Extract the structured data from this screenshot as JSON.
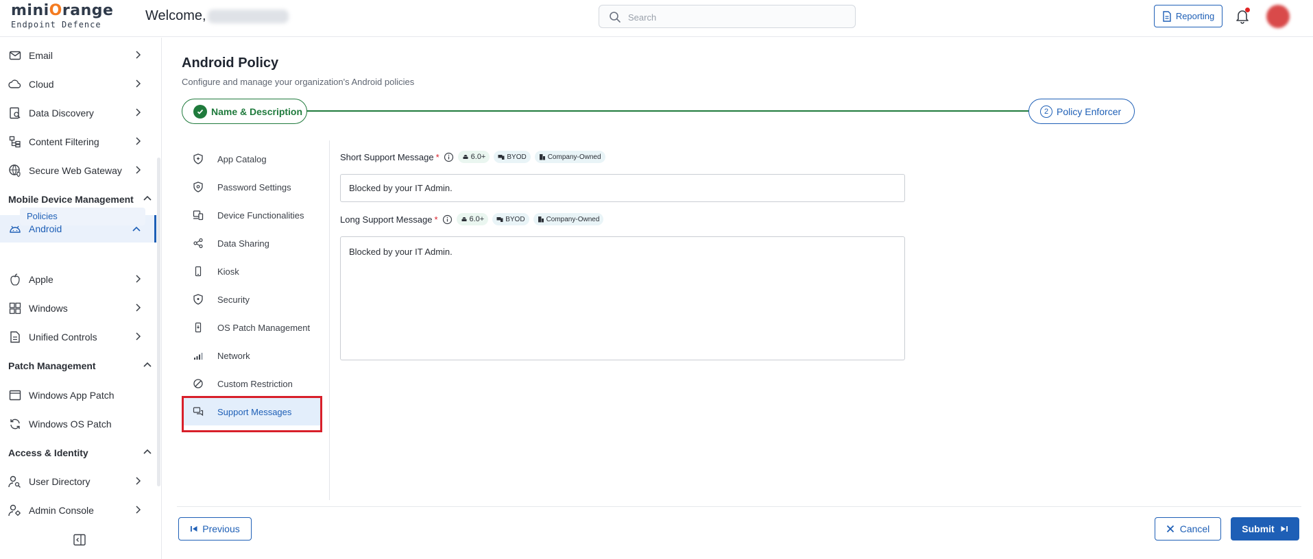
{
  "header": {
    "brand_prefix": "mini",
    "brand_o": "O",
    "brand_suffix": "range",
    "brand_sub": "Endpoint Defence",
    "welcome": "Welcome,",
    "search_placeholder": "Search",
    "reporting_label": "Reporting"
  },
  "sidebar": {
    "items": [
      {
        "label": "Email",
        "icon": "mail-icon"
      },
      {
        "label": "Cloud",
        "icon": "cloud-icon"
      },
      {
        "label": "Data Discovery",
        "icon": "document-search-icon"
      },
      {
        "label": "Content Filtering",
        "icon": "filter-list-icon"
      },
      {
        "label": "Secure Web Gateway",
        "icon": "globe-shield-icon"
      }
    ],
    "section_mdm": "Mobile Device Management",
    "android_label": "Android",
    "policies_label": "Policies",
    "apple_label": "Apple",
    "windows_label": "Windows",
    "unified_label": "Unified Controls",
    "section_patch": "Patch Management",
    "windows_app_patch": "Windows App Patch",
    "windows_os_patch": "Windows OS Patch",
    "section_access": "Access & Identity",
    "user_directory": "User Directory",
    "admin_console": "Admin Console"
  },
  "main": {
    "title": "Android Policy",
    "subtitle": "Configure and manage your organization's Android policies",
    "step1_label": "Name & Description",
    "step2_number": "2",
    "step2_label": "Policy Enforcer"
  },
  "policy_nav": [
    "App Catalog",
    "Password Settings",
    "Device Functionalities",
    "Data Sharing",
    "Kiosk",
    "Security",
    "OS Patch Management",
    "Network",
    "Custom Restriction",
    "Support Messages"
  ],
  "fields": {
    "short_label": "Short Support Message",
    "short_value": "Blocked by your IT Admin.",
    "long_label": "Long Support Message",
    "long_value": "Blocked by your IT Admin.",
    "required_mark": "*",
    "badge_version": "6.0+",
    "badge_byod": "BYOD",
    "badge_company": "Company-Owned"
  },
  "footer": {
    "previous": "Previous",
    "cancel": "Cancel",
    "submit": "Submit"
  },
  "colors": {
    "accent": "#1e5fb6",
    "success": "#1f7a3c",
    "highlight": "#d81f2a"
  }
}
